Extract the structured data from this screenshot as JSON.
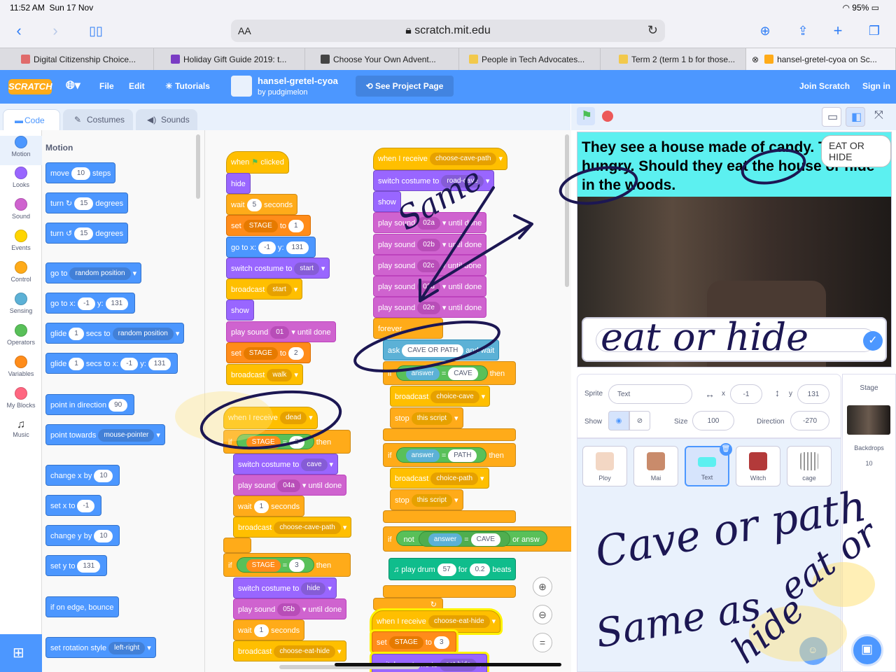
{
  "status": {
    "time": "11:52 AM",
    "date": "Sun 17 Nov",
    "battery": "95%"
  },
  "safari": {
    "aa": "AA",
    "host": "scratch.mit.edu"
  },
  "tabs": [
    {
      "label": "Digital Citizenship Choice...",
      "color": "#e06b6b"
    },
    {
      "label": "Holiday Gift Guide 2019: t...",
      "color": "#7a3cc4"
    },
    {
      "label": "Choose Your Own Advent...",
      "color": "#444444"
    },
    {
      "label": "People in Tech Advocates...",
      "color": "#f2c94c"
    },
    {
      "label": "Term 2 (term 1 b for those...",
      "color": "#f2c94c"
    },
    {
      "label": "hansel-gretel-cyoa on Sc...",
      "color": "#ffab19"
    }
  ],
  "menubar": {
    "logo": "SCRATCH",
    "file": "File",
    "edit": "Edit",
    "tutorials": "Tutorials",
    "project_title": "hansel-gretel-cyoa",
    "author": "by pudgimelon",
    "see_project": "See Project Page",
    "join": "Join Scratch",
    "signin": "Sign in"
  },
  "editor_tabs": {
    "code": "Code",
    "costumes": "Costumes",
    "sounds": "Sounds"
  },
  "categories": [
    {
      "label": "Motion",
      "color": "#4c97ff"
    },
    {
      "label": "Looks",
      "color": "#9966ff"
    },
    {
      "label": "Sound",
      "color": "#cf63cf"
    },
    {
      "label": "Events",
      "color": "#ffd500"
    },
    {
      "label": "Control",
      "color": "#ffab19"
    },
    {
      "label": "Sensing",
      "color": "#5cb1d6"
    },
    {
      "label": "Operators",
      "color": "#59c059"
    },
    {
      "label": "Variables",
      "color": "#ff8c1a"
    },
    {
      "label": "My Blocks",
      "color": "#ff6680"
    },
    {
      "label": "Music",
      "color": "#0fbd8c"
    }
  ],
  "flyout": {
    "title": "Motion",
    "move": {
      "a": "move",
      "v": "10",
      "b": "steps"
    },
    "turn_r": {
      "a": "turn",
      "v": "15",
      "b": "degrees"
    },
    "turn_l": {
      "a": "turn",
      "v": "15",
      "b": "degrees"
    },
    "goto": {
      "a": "go to",
      "d": "random position"
    },
    "gotoxy": {
      "a": "go to x:",
      "x": "-1",
      "b": "y:",
      "y": "131"
    },
    "glide": {
      "a": "glide",
      "v": "1",
      "b": "secs to",
      "d": "random position"
    },
    "glidexy": {
      "a": "glide",
      "v": "1",
      "b": "secs to x:",
      "x": "-1",
      "c": "y:",
      "y": "131"
    },
    "point_dir": {
      "a": "point in direction",
      "v": "90"
    },
    "point_tow": {
      "a": "point towards",
      "d": "mouse-pointer"
    },
    "chx": {
      "a": "change x by",
      "v": "10"
    },
    "setx": {
      "a": "set x to",
      "v": "-1"
    },
    "chy": {
      "a": "change y by",
      "v": "10"
    },
    "sety": {
      "a": "set y to",
      "v": "131"
    },
    "bounce": {
      "a": "if on edge, bounce"
    },
    "rot": {
      "a": "set rotation style",
      "d": "left-right"
    }
  },
  "script1": {
    "hat": {
      "a": "when",
      "b": "clicked"
    },
    "hide": "hide",
    "wait": {
      "a": "wait",
      "v": "5",
      "b": "seconds"
    },
    "set": {
      "a": "set",
      "d": "STAGE",
      "b": "to",
      "v": "1"
    },
    "gotoxy": {
      "a": "go to x:",
      "x": "-1",
      "b": "y:",
      "y": "131"
    },
    "costume": {
      "a": "switch costume to",
      "d": "start"
    },
    "broadcast": {
      "a": "broadcast",
      "d": "start"
    },
    "show": "show",
    "play": {
      "a": "play sound",
      "d": "01",
      "b": "until done"
    },
    "set2": {
      "a": "set",
      "d": "STAGE",
      "b": "to",
      "v": "2"
    },
    "broadcast2": {
      "a": "broadcast",
      "d": "walk"
    }
  },
  "script2": {
    "hat": {
      "a": "when I receive",
      "d": "dead"
    },
    "if1": {
      "a": "if",
      "d": "STAGE",
      "eq": "=",
      "v": "2",
      "b": "then"
    },
    "costume": {
      "a": "switch costume to",
      "d": "cave"
    },
    "play": {
      "a": "play sound",
      "d": "04a",
      "b": "until done"
    },
    "wait": {
      "a": "wait",
      "v": "1",
      "b": "seconds"
    },
    "broadcast": {
      "a": "broadcast",
      "d": "choose-cave-path"
    },
    "if2": {
      "a": "if",
      "d": "STAGE",
      "eq": "=",
      "v": "3",
      "b": "then"
    },
    "costume2": {
      "a": "switch costume to",
      "d": "hide"
    },
    "play2": {
      "a": "play sound",
      "d": "05b",
      "b": "until done"
    },
    "wait2": {
      "a": "wait",
      "v": "1",
      "b": "seconds"
    },
    "broadcast2": {
      "a": "broadcast",
      "d": "choose-eat-hide"
    }
  },
  "script3": {
    "hat": {
      "a": "when I receive",
      "d": "choose-cave-path"
    },
    "costume": {
      "a": "switch costume to",
      "d": "road-cave"
    },
    "show": "show",
    "p1": {
      "a": "play sound",
      "d": "02a",
      "b": "until done"
    },
    "p2": {
      "a": "play sound",
      "d": "02b",
      "b": "until done"
    },
    "p3": {
      "a": "play sound",
      "d": "02c",
      "b": "until done"
    },
    "p4": {
      "a": "play sound",
      "d": "02d",
      "b": "until done"
    },
    "p5": {
      "a": "play sound",
      "d": "02e",
      "b": "until done"
    },
    "forever": "forever",
    "ask": {
      "a": "ask",
      "d": "CAVE OR PATH",
      "b": "and wait"
    },
    "if1": {
      "a": "if",
      "r": "answer",
      "eq": "=",
      "v": "CAVE",
      "b": "then"
    },
    "b1": {
      "a": "broadcast",
      "d": "choice-cave"
    },
    "stop1": {
      "a": "stop",
      "d": "this script"
    },
    "if2": {
      "a": "if",
      "r": "answer",
      "eq": "=",
      "v": "PATH",
      "b": "then"
    },
    "b2": {
      "a": "broadcast",
      "d": "choice-path"
    },
    "stop2": {
      "a": "stop",
      "d": "this script"
    },
    "if3": {
      "a": "if",
      "not": "not",
      "r": "answer",
      "eq": "=",
      "v": "CAVE",
      "or": "or",
      "r2": "answ"
    },
    "drum": {
      "a": "play drum",
      "v": "57",
      "b": "for",
      "v2": "0.2",
      "c": "beats"
    }
  },
  "script4": {
    "hat": {
      "a": "when I receive",
      "d": "choose-eat-hide"
    },
    "set": {
      "a": "set",
      "d": "STAGE",
      "b": "to",
      "v": "3"
    },
    "costume": {
      "a": "switch costume to",
      "d": "eat-hide"
    }
  },
  "stage": {
    "text": "They see a house made of candy. They are hungry. Should they eat the house or hide in the woods.",
    "bubble": "EAT OR HIDE",
    "answer": ""
  },
  "sprite_info": {
    "sprite_label": "Sprite",
    "name": "Text",
    "x_label": "x",
    "x": "-1",
    "y_label": "y",
    "y": "131",
    "show_label": "Show",
    "size_label": "Size",
    "size": "100",
    "dir_label": "Direction",
    "direction": "-270"
  },
  "sprites": [
    {
      "name": "Ploy",
      "color": "#f3d7c4"
    },
    {
      "name": "Mai",
      "color": "#c98b6b"
    },
    {
      "name": "Text",
      "color": "#5cf0f0"
    },
    {
      "name": "Witch",
      "color": "#b33a3a"
    },
    {
      "name": "cage",
      "color": "#999999"
    }
  ],
  "stage_pane": {
    "label": "Stage",
    "backdrops_label": "Backdrops",
    "backdrops_count": "10"
  },
  "annotations": {
    "same": "Same",
    "eat_or_hide": "eat or hide",
    "cave_or_path": "Cave or path",
    "same_as": "Same as",
    "eat_or": "eat or",
    "hide": "hide"
  }
}
